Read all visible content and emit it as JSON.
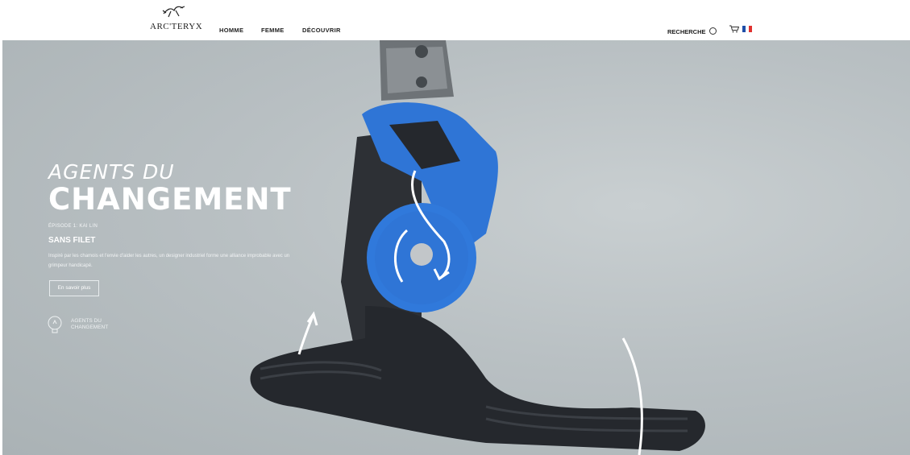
{
  "brand": {
    "name": "ARC'TERYX",
    "logo_text": "ARC'TERYX"
  },
  "nav": {
    "items": [
      {
        "label": "HOMME"
      },
      {
        "label": "FEMME"
      },
      {
        "label": "DÉCOUVRIR"
      }
    ]
  },
  "utility": {
    "search_label": "RECHERCHE"
  },
  "hero": {
    "title_line1": "AGENTS DU",
    "title_line2": "CHANGEMENT",
    "episode": "ÉPISODE 1: KAI LIN",
    "subtitle": "SANS FILET",
    "description": "Inspiré par les chamois et l'envie d'aider les autres, un designer industriel forme une alliance improbable avec un grimpeur handicapé.",
    "cta_label": "En savoir plus",
    "badge_line1": "AGENTS DU",
    "badge_line2": "CHANGEMENT"
  },
  "colors": {
    "hero_background": "#b9c0c3",
    "prosthetic_blue": "#2f75d6",
    "foot_dark": "#25282d",
    "flag": [
      "#1f4ea8",
      "#ffffff",
      "#e0312f"
    ]
  }
}
